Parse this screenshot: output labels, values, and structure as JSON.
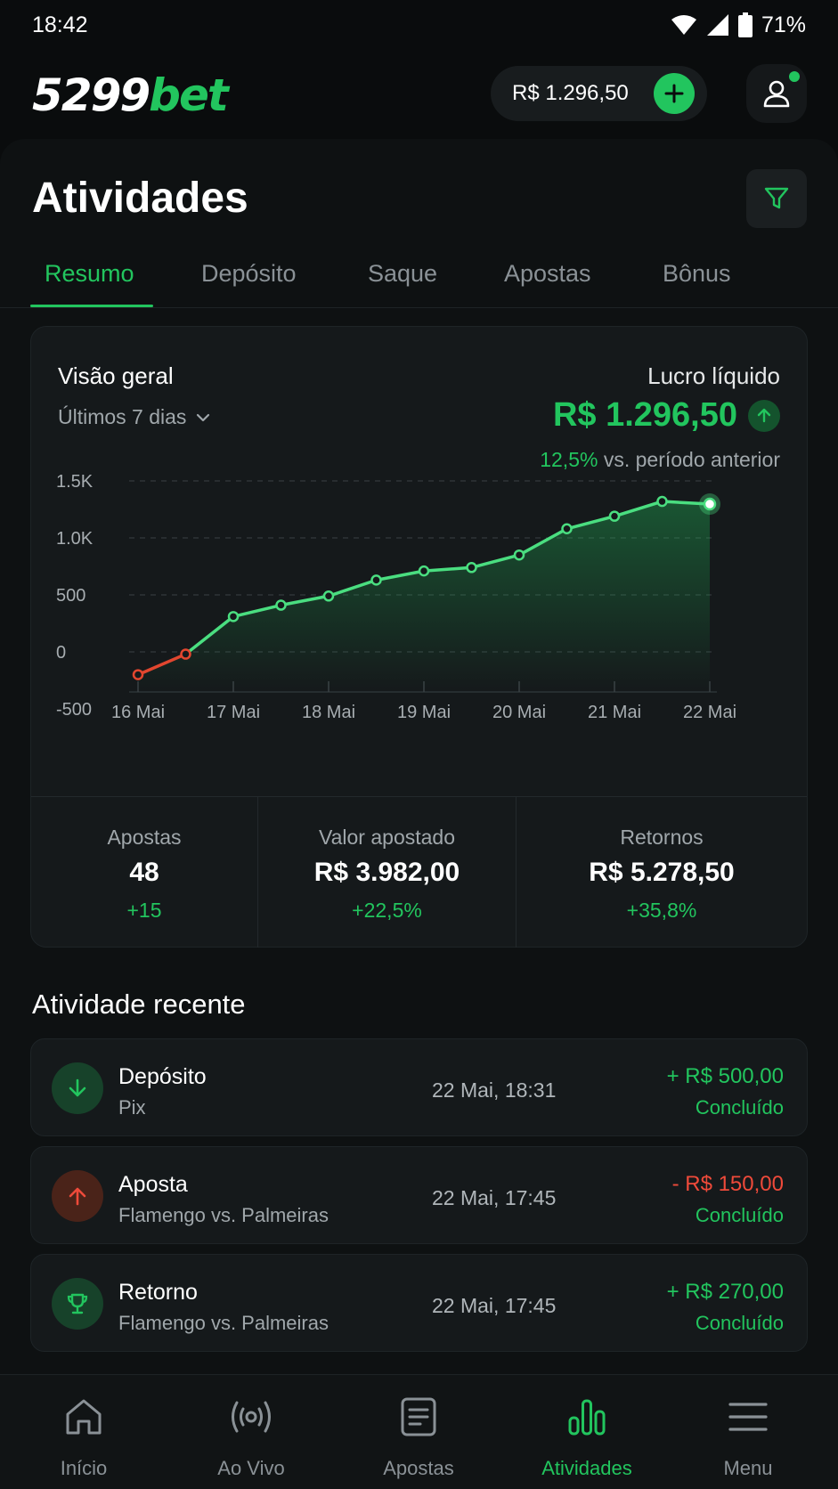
{
  "status_bar": {
    "time": "18:42",
    "battery": "71%"
  },
  "header": {
    "logo_number": "5299",
    "logo_suffix": "bet",
    "balance": "R$ 1.296,50"
  },
  "page": {
    "title": "Atividades",
    "tabs": [
      {
        "label": "Resumo",
        "active": true
      },
      {
        "label": "Depósito",
        "active": false
      },
      {
        "label": "Saque",
        "active": false
      },
      {
        "label": "Apostas",
        "active": false
      },
      {
        "label": "Bônus",
        "active": false
      }
    ]
  },
  "overview": {
    "title": "Visão geral",
    "period": "Últimos 7 dias",
    "profit_label": "Lucro líquido",
    "profit_value": "R$ 1.296,50",
    "change_pct": "12,5%",
    "change_text": "vs. período anterior"
  },
  "chart_data": {
    "type": "area",
    "x_tick_labels": [
      "16 Mai",
      "17 Mai",
      "18 Mai",
      "19 Mai",
      "20 Mai",
      "21 Mai",
      "22 Mai"
    ],
    "y_tick_labels": [
      "1.5K",
      "1.0K",
      "500",
      "0",
      "-500"
    ],
    "y_ticks": [
      1500,
      1000,
      500,
      0,
      -500
    ],
    "ylim": [
      -500,
      1500
    ],
    "grid": true,
    "points": [
      {
        "x": 0,
        "y": -200
      },
      {
        "x": 0.5,
        "y": -20
      },
      {
        "x": 1,
        "y": 310
      },
      {
        "x": 1.5,
        "y": 410
      },
      {
        "x": 2,
        "y": 490
      },
      {
        "x": 2.5,
        "y": 630
      },
      {
        "x": 3,
        "y": 710
      },
      {
        "x": 3.5,
        "y": 740
      },
      {
        "x": 4,
        "y": 850
      },
      {
        "x": 4.5,
        "y": 1080
      },
      {
        "x": 5,
        "y": 1190
      },
      {
        "x": 5.5,
        "y": 1320
      },
      {
        "x": 6,
        "y": 1296.5
      }
    ],
    "colors": {
      "positive": "#22c55e",
      "negative": "#e2462f"
    }
  },
  "stats": [
    {
      "label": "Apostas",
      "value": "48",
      "delta": "+15"
    },
    {
      "label": "Valor apostado",
      "value": "R$ 3.982,00",
      "delta": "+22,5%"
    },
    {
      "label": "Retornos",
      "value": "R$ 5.278,50",
      "delta": "+35,8%"
    }
  ],
  "recent": {
    "title": "Atividade recente",
    "items": [
      {
        "icon": "arrow-down-icon",
        "title": "Depósito",
        "subtitle": "Pix",
        "date": "22 Mai, 18:31",
        "amount": "+ R$ 500,00",
        "status": "Concluído"
      },
      {
        "icon": "arrow-up-icon",
        "title": "Aposta",
        "subtitle": "Flamengo vs. Palmeiras",
        "date": "22 Mai, 17:45",
        "amount": "- R$ 150,00",
        "status": "Concluído"
      },
      {
        "icon": "trophy-icon",
        "title": "Retorno",
        "subtitle": "Flamengo vs. Palmeiras",
        "date": "22 Mai, 17:45",
        "amount": "+ R$ 270,00",
        "status": "Concluído"
      }
    ]
  },
  "bottom_nav": [
    {
      "label": "Início",
      "icon": "home-icon"
    },
    {
      "label": "Ao Vivo",
      "icon": "live-icon"
    },
    {
      "label": "Apostas",
      "icon": "betslip-icon"
    },
    {
      "label": "Atividades",
      "icon": "bar-chart-icon",
      "active": true
    },
    {
      "label": "Menu",
      "icon": "menu-icon"
    }
  ]
}
